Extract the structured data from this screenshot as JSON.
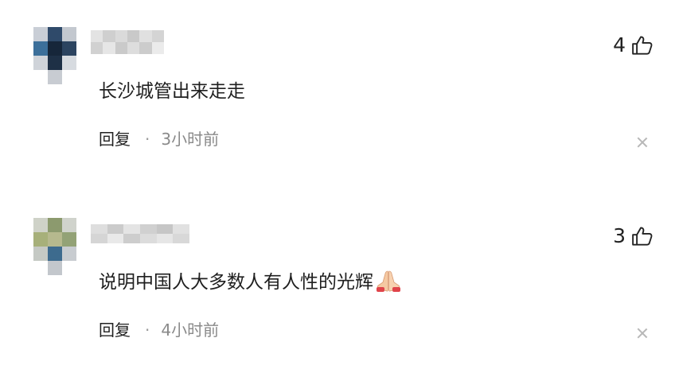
{
  "comments": [
    {
      "likes": "4",
      "text": "长沙城管出来走走",
      "reply_label": "回复",
      "separator": "·",
      "time": "3小时前"
    },
    {
      "likes": "3",
      "text": "说明中国人大多数人有人性的光辉",
      "emoji": "praying-hands",
      "reply_label": "回复",
      "separator": "·",
      "time": "4小时前"
    }
  ],
  "colors": {
    "text": "#1f1f1f",
    "meta": "#8a8a8a",
    "close": "#b8b8b8"
  }
}
